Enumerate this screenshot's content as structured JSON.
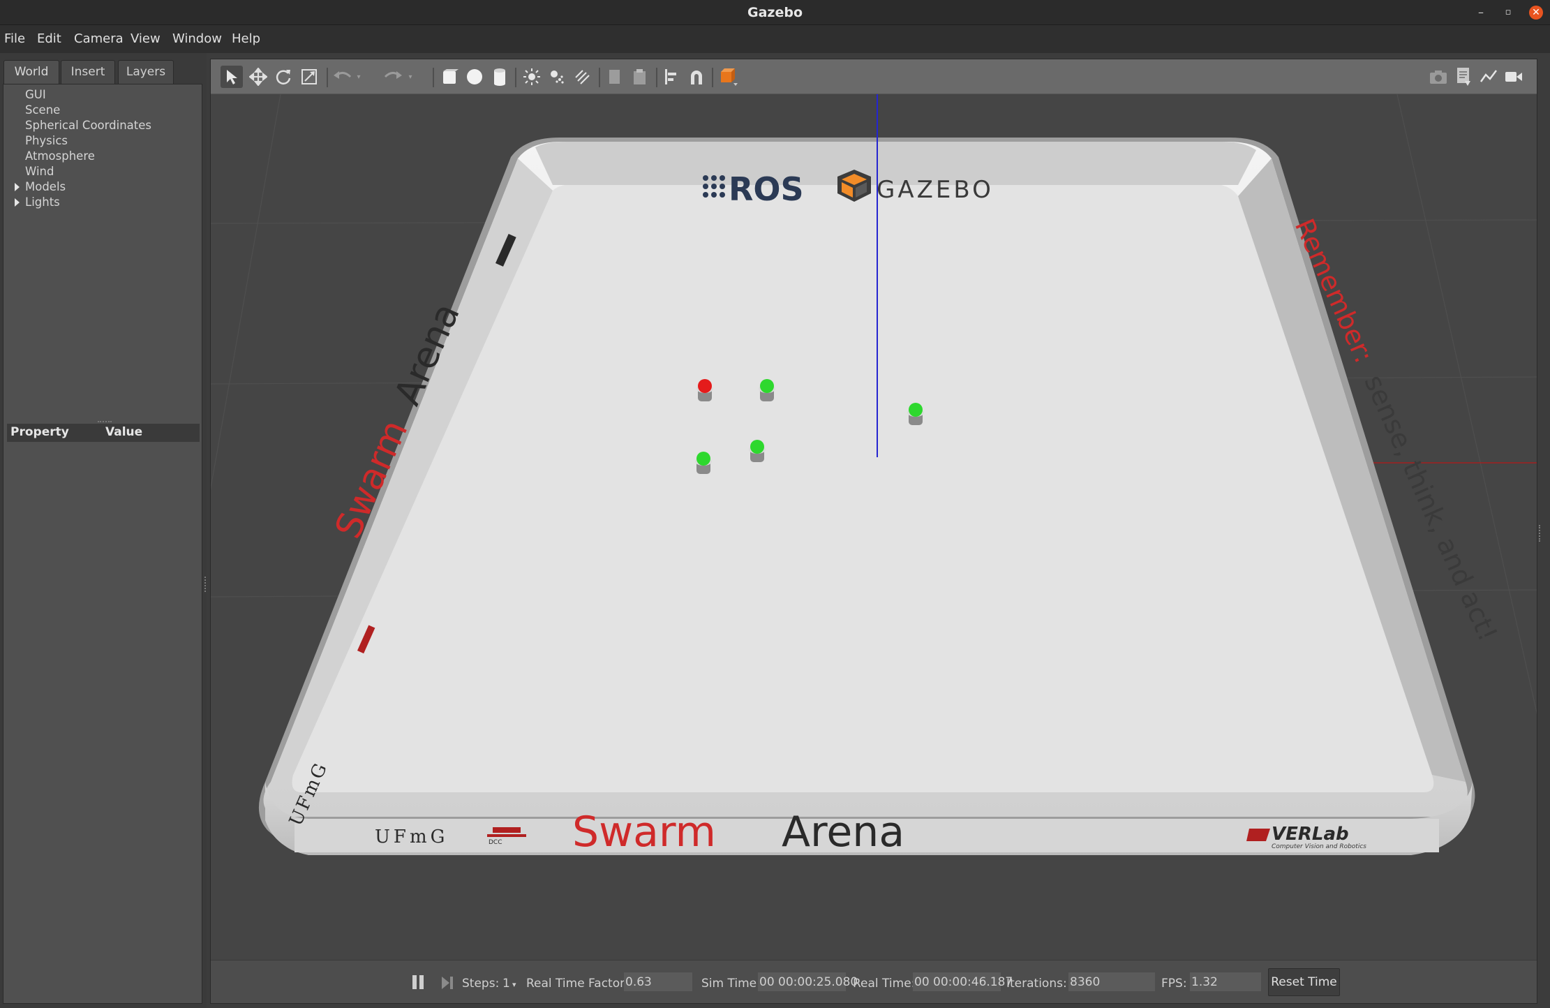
{
  "window": {
    "title": "Gazebo"
  },
  "menu": [
    "File",
    "Edit",
    "Camera",
    "View",
    "Window",
    "Help"
  ],
  "left_panel": {
    "tabs": [
      "World",
      "Insert",
      "Layers"
    ],
    "active_tab": "World",
    "tree": [
      {
        "label": "GUI",
        "expandable": false
      },
      {
        "label": "Scene",
        "expandable": false
      },
      {
        "label": "Spherical Coordinates",
        "expandable": false
      },
      {
        "label": "Physics",
        "expandable": false
      },
      {
        "label": "Atmosphere",
        "expandable": false
      },
      {
        "label": "Wind",
        "expandable": false
      },
      {
        "label": "Models",
        "expandable": true
      },
      {
        "label": "Lights",
        "expandable": true
      }
    ],
    "property_header": {
      "property": "Property",
      "value": "Value"
    }
  },
  "toolbar": {
    "tools": [
      "select-arrow-icon",
      "translate-icon",
      "rotate-icon",
      "scale-icon",
      "undo-icon",
      "redo-icon",
      "box-icon",
      "sphere-icon",
      "cylinder-icon",
      "point-light-icon",
      "spot-light-icon",
      "directional-light-icon",
      "copy-icon",
      "paste-icon",
      "align-icon",
      "snap-magnet-icon",
      "view-angle-icon"
    ],
    "right_tools": [
      "screenshot-icon",
      "log-icon",
      "plot-icon",
      "record-video-icon"
    ],
    "accent": "#e8761c"
  },
  "scene": {
    "banner_top_ros": "ROS",
    "banner_top_gazebo": "GAZEBO",
    "left_wall_text": "Swarm Arena",
    "right_wall_text_red": "Remember:",
    "right_wall_text": "sense, think, and act!",
    "front_wall_text_red": "Swarm",
    "front_wall_text_dark": "Arena",
    "ufmg_logo": "UFmG",
    "dcc_logo": "DCC",
    "verlab_logo": "VERLab",
    "verlab_sub": "Computer Vision and Robotics",
    "robots": [
      {
        "color": "#e41b1b"
      },
      {
        "color": "#2ed82e"
      },
      {
        "color": "#2ed82e"
      },
      {
        "color": "#2ed82e"
      },
      {
        "color": "#2ed82e"
      }
    ]
  },
  "statusbar": {
    "steps_label": "Steps:",
    "steps_value": "1",
    "rtf_label": "Real Time Factor:",
    "rtf_value": "0.63",
    "sim_time_label": "Sim Time:",
    "sim_time_value": "00 00:00:25.080",
    "real_time_label": "Real Time:",
    "real_time_value": "00 00:00:46.187",
    "iterations_label": "Iterations:",
    "iterations_value": "8360",
    "fps_label": "FPS:",
    "fps_value": "1.32",
    "reset_label": "Reset Time"
  }
}
